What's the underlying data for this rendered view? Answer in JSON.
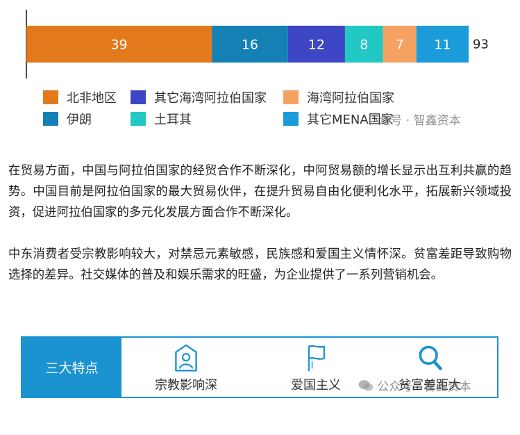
{
  "chart_data": {
    "type": "bar",
    "orientation": "horizontal",
    "stacked": true,
    "series": [
      {
        "name": "北非地区",
        "value": 39,
        "color": "#e2791d"
      },
      {
        "name": "伊朗",
        "value": 16,
        "color": "#1480b3"
      },
      {
        "name": "其它海湾阿拉伯国家",
        "value": 12,
        "color": "#3d47c5"
      },
      {
        "name": "土耳其",
        "value": 8,
        "color": "#22c8c4"
      },
      {
        "name": "海湾阿拉伯国家",
        "value": 7,
        "color": "#f5a161"
      },
      {
        "name": "其它MENA国家",
        "value": 11,
        "color": "#1b9bd9"
      }
    ],
    "total": 93,
    "legend_order": [
      "北非地区",
      "其它海湾阿拉伯国家",
      "海湾阿拉伯国家",
      "伊朗",
      "土耳其",
      "其它MENA国家"
    ],
    "legend_position": "bottom",
    "grid": false
  },
  "watermark_chart": "众号 · 智鑫资本",
  "paragraphs": [
    "在贸易方面，中国与阿拉伯国家的经贸合作不断深化，中阿贸易额的增长显示出互利共赢的趋势。中国目前是阿拉伯国家的最大贸易伙伴，在提升贸易自由化便利化水平，拓展新兴领域投资，促进阿拉伯国家的多元化发展方面合作不断深化。",
    "中东消费者受宗教影响较大，对禁忌元素敏感，民族感和爱国主义情怀深。贫富差距导致购物选择的差异。社交媒体的普及和娱乐需求的旺盛，为企业提供了一系列营销机会。"
  ],
  "features": {
    "title": "三大特点",
    "accent_color": "#1b93d1",
    "items": [
      {
        "label": "宗教影响深",
        "icon": "person-frame-icon"
      },
      {
        "label": "爱国主义",
        "icon": "flag-icon"
      },
      {
        "label": "贫富差距大",
        "icon": "magnifier-icon"
      }
    ],
    "watermark": "公众号 · 智鑫资本"
  }
}
